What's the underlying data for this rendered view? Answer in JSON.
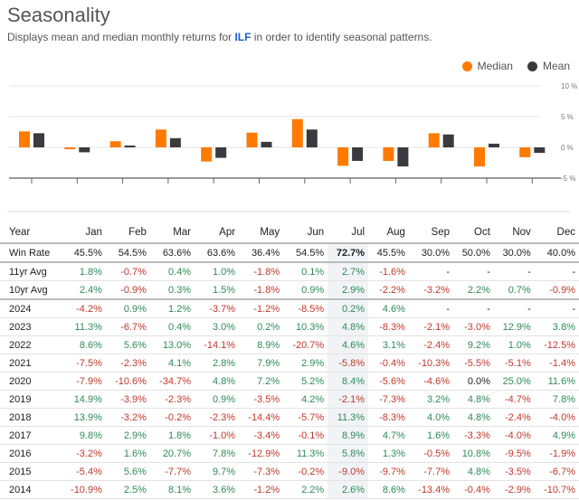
{
  "header": {
    "title": "Seasonality",
    "subtitle_prefix": "Displays mean and median monthly returns for ",
    "ticker": "ILF",
    "subtitle_suffix": " in order to identify seasonal patterns."
  },
  "legend": {
    "median_label": "Median",
    "mean_label": "Mean"
  },
  "colors": {
    "median": "#ff7a00",
    "mean": "#3a3a3f",
    "positive": "#2e8b57",
    "negative": "#c0392b",
    "ticker_link": "#1a5fc8"
  },
  "chart_data": {
    "type": "bar",
    "title": "",
    "xlabel": "",
    "ylabel": "",
    "categories": [
      "Jan",
      "Feb",
      "Mar",
      "Apr",
      "May",
      "Jun",
      "Jul",
      "Aug",
      "Sep",
      "Oct",
      "Nov",
      "Dec"
    ],
    "series": [
      {
        "name": "Median",
        "values": [
          2.6,
          -0.3,
          1.0,
          2.9,
          -2.3,
          2.4,
          4.6,
          -3.0,
          -2.2,
          2.3,
          -3.1,
          -1.6
        ]
      },
      {
        "name": "Mean",
        "values": [
          2.3,
          -0.8,
          0.3,
          1.5,
          -1.7,
          0.9,
          2.9,
          -2.2,
          -3.1,
          2.1,
          0.6,
          -0.9
        ]
      }
    ],
    "ylim": [
      -5,
      10
    ],
    "yticks": [
      -5,
      0,
      5,
      10
    ],
    "ytick_labels": [
      "-5 %",
      "0 %",
      "5 %",
      "10 %"
    ],
    "grid": true,
    "legend_position": "top-right"
  },
  "table": {
    "columns": [
      "Year",
      "Jan",
      "Feb",
      "Mar",
      "Apr",
      "May",
      "Jun",
      "Jul",
      "Aug",
      "Sep",
      "Oct",
      "Nov",
      "Dec"
    ],
    "highlight_column": "Jul",
    "win_rate": {
      "label": "Win Rate",
      "values": [
        "45.5%",
        "54.5%",
        "63.6%",
        "63.6%",
        "36.4%",
        "54.5%",
        "72.7%",
        "45.5%",
        "30.0%",
        "50.0%",
        "30.0%",
        "40.0%"
      ]
    },
    "averages": [
      {
        "label": "11yr Avg",
        "values": [
          "1.8%",
          "-0.7%",
          "0.4%",
          "1.0%",
          "-1.8%",
          "0.1%",
          "2.7%",
          "-1.6%",
          "-",
          "-",
          "-",
          "-"
        ]
      },
      {
        "label": "10yr Avg",
        "values": [
          "2.4%",
          "-0.9%",
          "0.3%",
          "1.5%",
          "-1.8%",
          "0.9%",
          "2.9%",
          "-2.2%",
          "-3.2%",
          "2.2%",
          "0.7%",
          "-0.9%"
        ]
      }
    ],
    "years": [
      {
        "label": "2024",
        "values": [
          "-4.2%",
          "0.9%",
          "1.2%",
          "-3.7%",
          "-1.2%",
          "-8.5%",
          "0.2%",
          "4.6%",
          "-",
          "-",
          "-",
          "-"
        ]
      },
      {
        "label": "2023",
        "values": [
          "11.3%",
          "-6.7%",
          "0.4%",
          "3.0%",
          "0.2%",
          "10.3%",
          "4.8%",
          "-8.3%",
          "-2.1%",
          "-3.0%",
          "12.9%",
          "3.8%"
        ]
      },
      {
        "label": "2022",
        "values": [
          "8.6%",
          "5.6%",
          "13.0%",
          "-14.1%",
          "8.9%",
          "-20.7%",
          "4.6%",
          "3.1%",
          "-2.4%",
          "9.2%",
          "1.0%",
          "-12.5%"
        ]
      },
      {
        "label": "2021",
        "values": [
          "-7.5%",
          "-2.3%",
          "4.1%",
          "2.8%",
          "7.9%",
          "2.9%",
          "-5.8%",
          "-0.4%",
          "-10.3%",
          "-5.5%",
          "-5.1%",
          "-1.4%"
        ]
      },
      {
        "label": "2020",
        "values": [
          "-7.9%",
          "-10.6%",
          "-34.7%",
          "4.8%",
          "7.2%",
          "5.2%",
          "8.4%",
          "-5.6%",
          "-4.6%",
          "0.0%",
          "25.0%",
          "11.6%"
        ]
      },
      {
        "label": "2019",
        "values": [
          "14.9%",
          "-3.9%",
          "-2.3%",
          "0.9%",
          "-3.5%",
          "4.2%",
          "-2.1%",
          "-7.3%",
          "3.2%",
          "4.8%",
          "-4.7%",
          "7.8%"
        ]
      },
      {
        "label": "2018",
        "values": [
          "13.9%",
          "-3.2%",
          "-0.2%",
          "-2.3%",
          "-14.4%",
          "-5.7%",
          "11.3%",
          "-8.3%",
          "4.0%",
          "4.8%",
          "-2.4%",
          "-4.0%"
        ]
      },
      {
        "label": "2017",
        "values": [
          "9.8%",
          "2.9%",
          "1.8%",
          "-1.0%",
          "-3.4%",
          "-0.1%",
          "8.9%",
          "4.7%",
          "1.6%",
          "-3.3%",
          "-4.0%",
          "4.9%"
        ]
      },
      {
        "label": "2016",
        "values": [
          "-3.2%",
          "1.6%",
          "20.7%",
          "7.8%",
          "-12.9%",
          "11.3%",
          "5.8%",
          "1.3%",
          "-0.5%",
          "10.8%",
          "-9.5%",
          "-1.9%"
        ]
      },
      {
        "label": "2015",
        "values": [
          "-5.4%",
          "5.6%",
          "-7.7%",
          "9.7%",
          "-7.3%",
          "-0.2%",
          "-9.0%",
          "-9.7%",
          "-7.7%",
          "4.8%",
          "-3.5%",
          "-6.7%"
        ]
      },
      {
        "label": "2014",
        "values": [
          "-10.9%",
          "2.5%",
          "8.1%",
          "3.6%",
          "-1.2%",
          "2.2%",
          "2.6%",
          "8.6%",
          "-13.4%",
          "-0.4%",
          "-2.9%",
          "-10.7%"
        ]
      }
    ]
  }
}
